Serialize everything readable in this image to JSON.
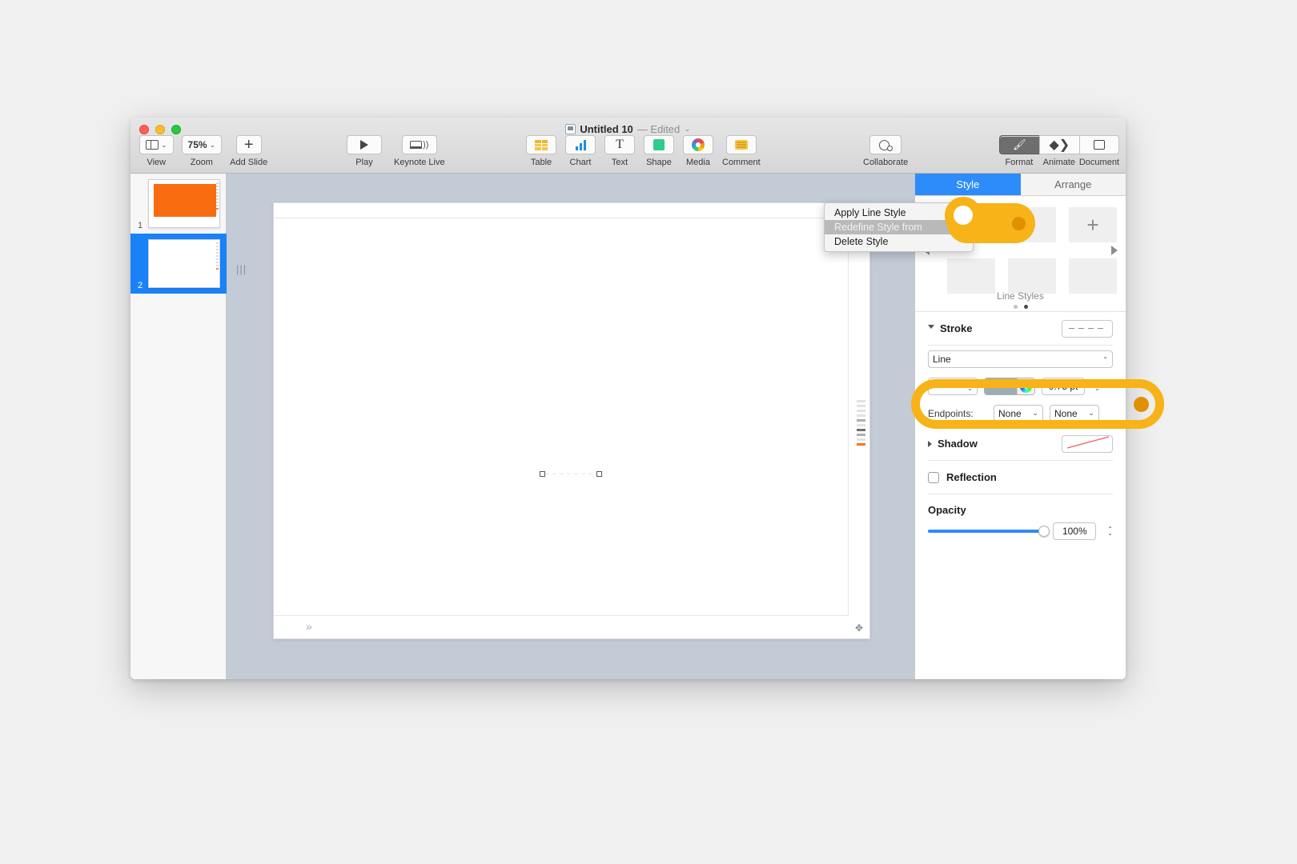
{
  "app": {
    "window_title": "Untitled 10",
    "title_status": "— Edited",
    "title_chevron": "⌄",
    "doc_icon": "keynote-document-icon"
  },
  "traffic_lights": {
    "close": "close-button",
    "minimize": "minimize-button",
    "zoom": "zoom-button"
  },
  "toolbar": {
    "left_items": [
      {
        "label": "View",
        "icon": "view-panes-icon",
        "value": ""
      },
      {
        "label": "Zoom",
        "icon": "zoom-percent",
        "value": "75%"
      },
      {
        "label": "Add Slide",
        "icon": "plus-icon",
        "value": ""
      }
    ],
    "play_items": [
      {
        "label": "Play",
        "icon": "play-triangle-icon"
      },
      {
        "label": "Keynote Live",
        "icon": "keynote-live-icon"
      }
    ],
    "insert_items": [
      {
        "label": "Table",
        "icon": "table-icon"
      },
      {
        "label": "Chart",
        "icon": "chart-icon"
      },
      {
        "label": "Text",
        "icon": "text-icon"
      },
      {
        "label": "Shape",
        "icon": "shape-icon"
      },
      {
        "label": "Media",
        "icon": "media-icon"
      },
      {
        "label": "Comment",
        "icon": "comment-icon"
      }
    ],
    "collaborate": {
      "label": "Collaborate",
      "icon": "collaborate-icon"
    },
    "inspector_tabs": [
      {
        "label": "Format",
        "icon": "format-brush-icon",
        "active": true
      },
      {
        "label": "Animate",
        "icon": "animate-diamond-icon",
        "active": false
      },
      {
        "label": "Document",
        "icon": "document-icon",
        "active": false
      }
    ]
  },
  "navigator": {
    "slides": [
      {
        "number": "1",
        "selected": false,
        "content": "orange-rectangle"
      },
      {
        "number": "2",
        "selected": true,
        "content": "blank"
      }
    ]
  },
  "canvas": {
    "markers": {
      "top_left": "»",
      "top_right": "»",
      "bottom_left": "»",
      "drag_handle": "|||"
    },
    "selected_object": "dashed-line-shape",
    "crosshair_icon": "move-crosshair-icon"
  },
  "context_menu": {
    "items": [
      {
        "label": "Apply Line Style",
        "state": "normal"
      },
      {
        "label": "Redefine Style from Selection",
        "state": "highlighted-disabled"
      },
      {
        "label": "Delete Style",
        "state": "normal"
      }
    ]
  },
  "inspector": {
    "tabs": [
      {
        "label": "Style",
        "active": true
      },
      {
        "label": "Arrange",
        "active": false
      }
    ],
    "style_picker": {
      "label": "Line Styles",
      "add_button": "+",
      "prev_arrow": "prev-style-page",
      "next_arrow": "next-style-page",
      "page_dots": [
        {
          "active": false
        },
        {
          "active": true
        }
      ],
      "swatch_count": 6
    },
    "stroke": {
      "title": "Stroke",
      "expanded": true,
      "preset_preview": "dashed-line-preview",
      "line_type_label": "Line",
      "dash_style": "dashed",
      "color_value": "#9dacb5",
      "width_value": "0.75 pt",
      "endpoints_label": "Endpoints:",
      "endpoint_start": "None",
      "endpoint_end": "None"
    },
    "shadow": {
      "title": "Shadow",
      "expanded": false,
      "preview": "red-diagonal-line"
    },
    "reflection": {
      "title": "Reflection",
      "checked": false
    },
    "opacity": {
      "title": "Opacity",
      "value": "100%",
      "percent": 100
    }
  },
  "annotations": {
    "callout_1": "highlight-style-swatch",
    "callout_2": "highlight-stroke-line-row"
  },
  "colors": {
    "accent_blue": "#2d8cf9",
    "highlight_orange": "#f7b317",
    "highlight_dot": "#e09000",
    "slide_orange": "#f96c10",
    "canvas_bg": "#c3cbd6"
  }
}
